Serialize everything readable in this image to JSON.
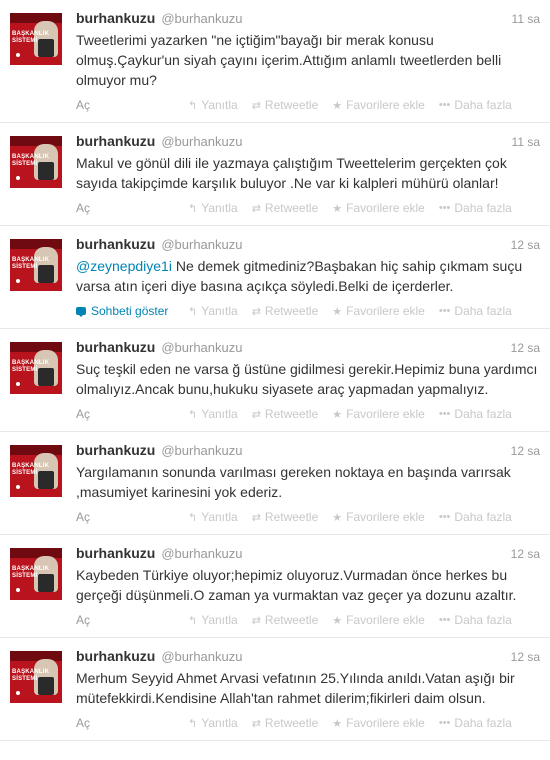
{
  "actions": {
    "expand": "Aç",
    "reply": "Yanıtla",
    "retweet": "Retweetle",
    "favorite": "Favorilere ekle",
    "more": "Daha fazla",
    "conversation": "Sohbeti göster"
  },
  "avatar": {
    "caption_line1": "BAŞKANLIK",
    "caption_line2": "SİSTEMİ"
  },
  "icons": {
    "reply": "reply-arrow-icon",
    "retweet": "retweet-icon",
    "favorite": "star-icon",
    "more": "dots-icon",
    "conversation": "speech-bubble-icon"
  },
  "colors": {
    "link": "#0084b4",
    "muted": "#999999",
    "action": "#c8c8c8",
    "text": "#333333",
    "avatar": "#b9141d"
  },
  "tweets": [
    {
      "fullname": "burhankuzu",
      "username": "@burhankuzu",
      "time": "11 sa",
      "text": "Tweetlerimi yazarken \"ne içtiğim\"bayağı bir merak konusu olmuş.Çaykur'un siyah çayını içerim.Attığım anlamlı tweetlerden belli olmuyor mu?"
    },
    {
      "fullname": "burhankuzu",
      "username": "@burhankuzu",
      "time": "11 sa",
      "text": "Makul ve gönül dili ile yazmaya çalıştığım Tweettelerim gerçekten çok sayıda takipçimde karşılık buluyor .Ne var ki kalpleri mühürü olanlar!"
    },
    {
      "fullname": "burhankuzu",
      "username": "@burhankuzu",
      "time": "12 sa",
      "mention": "@zeynepdiye1i",
      "text": " Ne demek gitmediniz?Başbakan hiç sahip çıkmam suçu varsa atın içeri diye basına  açıkça söyledi.Belki de içerderler."
    },
    {
      "fullname": "burhankuzu",
      "username": "@burhankuzu",
      "time": "12 sa",
      "text": "Suç teşkil eden ne varsa ğ üstüne gidilmesi gerekir.Hepimiz buna yardımcı olmalıyız.Ancak bunu,hukuku siyasete araç yapmadan yapmalıyız."
    },
    {
      "fullname": "burhankuzu",
      "username": "@burhankuzu",
      "time": "12 sa",
      "text": "Yargılamanın sonunda varılması gereken noktaya en başında varırsak ,masumiyet karinesini yok ederiz."
    },
    {
      "fullname": "burhankuzu",
      "username": "@burhankuzu",
      "time": "12 sa",
      "text": "Kaybeden Türkiye oluyor;hepimiz oluyoruz.Vurmadan önce herkes bu gerçeği düşünmeli.O zaman ya vurmaktan vaz geçer ya dozunu azaltır."
    },
    {
      "fullname": "burhankuzu",
      "username": "@burhankuzu",
      "time": "12 sa",
      "text": "Merhum Seyyid Ahmet Arvasi vefatının 25.Yılında anıldı.Vatan aşığı bir mütefekkirdi.Kendisine Allah'tan rahmet dilerim;fikirleri daim olsun."
    }
  ]
}
